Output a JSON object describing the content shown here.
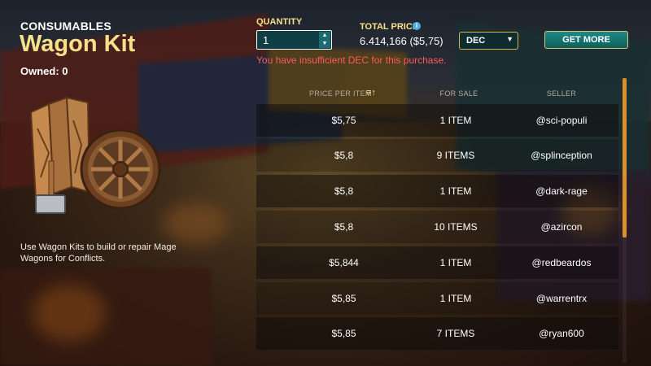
{
  "item": {
    "category": "CONSUMABLES",
    "name": "Wagon Kit",
    "owned": "Owned: 0",
    "description": "Use Wagon Kits to build or repair Mage Wagons for Conflicts."
  },
  "purchase": {
    "quantity_label": "QUANTITY",
    "quantity_value": "1",
    "total_price_label": "TOTAL PRICE",
    "total_price_value": "6.414,166 ($5,75)",
    "currency_selected": "DEC",
    "get_more_label": "GET MORE",
    "error_message": "You have insufficient DEC for this purchase."
  },
  "icons": {
    "info": "info-icon",
    "sort": "sort-ascending-icon",
    "spin_up": "chevron-up-icon",
    "spin_down": "chevron-down-icon",
    "select_caret": "chevron-down-icon"
  },
  "table": {
    "headers": {
      "price_per_item": "PRICE PER ITEM",
      "for_sale": "FOR SALE",
      "seller": "SELLER"
    },
    "rows": [
      {
        "price": "$5,75",
        "for_sale": "1 ITEM",
        "seller": "@sci-populi"
      },
      {
        "price": "$5,8",
        "for_sale": "9 ITEMS",
        "seller": "@splinception"
      },
      {
        "price": "$5,8",
        "for_sale": "1 ITEM",
        "seller": "@dark-rage"
      },
      {
        "price": "$5,8",
        "for_sale": "10 ITEMS",
        "seller": "@azircon"
      },
      {
        "price": "$5,844",
        "for_sale": "1 ITEM",
        "seller": "@redbeardos"
      },
      {
        "price": "$5,85",
        "for_sale": "1 ITEM",
        "seller": "@warrentrx"
      },
      {
        "price": "$5,85",
        "for_sale": "7 ITEMS",
        "seller": "@ryan600"
      }
    ]
  },
  "colors": {
    "accent_gold": "#f7e08a",
    "error_red": "#ff5a5a",
    "button_teal": "#1b8a86",
    "scroll_orange": "#d9922a"
  }
}
